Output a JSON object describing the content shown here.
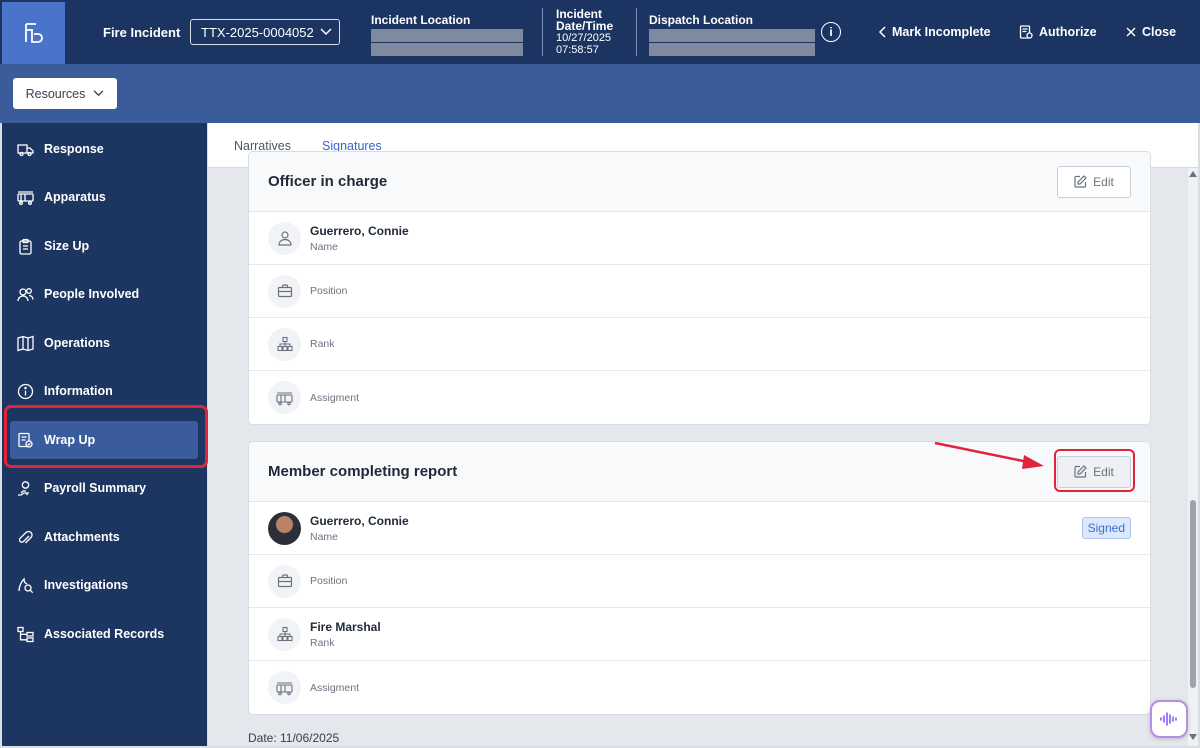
{
  "header": {
    "app_title": "Fire Incident",
    "incident_id": "TTX-2025-0004052",
    "incident_location_label": "Incident Location",
    "incident_datetime_label": "Incident Date/Time",
    "incident_date": "10/27/2025",
    "incident_time": "07:58:57",
    "dispatch_location_label": "Dispatch Location",
    "actions": {
      "mark_incomplete": "Mark Incomplete",
      "authorize": "Authorize",
      "close": "Close"
    }
  },
  "resources_button": "Resources",
  "sidebar": {
    "items": [
      {
        "label": "Response",
        "icon": "truck-icon"
      },
      {
        "label": "Apparatus",
        "icon": "fire-engine-icon"
      },
      {
        "label": "Size Up",
        "icon": "clipboard-icon"
      },
      {
        "label": "People Involved",
        "icon": "people-icon"
      },
      {
        "label": "Operations",
        "icon": "map-icon"
      },
      {
        "label": "Information",
        "icon": "info-icon"
      },
      {
        "label": "Wrap Up",
        "icon": "document-check-icon",
        "active": true
      },
      {
        "label": "Payroll Summary",
        "icon": "payroll-icon"
      },
      {
        "label": "Attachments",
        "icon": "paperclip-icon"
      },
      {
        "label": "Investigations",
        "icon": "investigation-icon"
      },
      {
        "label": "Associated Records",
        "icon": "hierarchy-icon"
      }
    ]
  },
  "tabs": [
    {
      "label": "Narratives"
    },
    {
      "label": "Signatures",
      "active": true
    }
  ],
  "officer_card": {
    "title": "Officer in charge",
    "edit_label": "Edit",
    "name_value": "Guerrero, Connie",
    "name_label": "Name",
    "position_label": "Position",
    "rank_label": "Rank",
    "assignment_label": "Assigment"
  },
  "member_card": {
    "title": "Member completing report",
    "edit_label": "Edit",
    "name_value": "Guerrero, Connie",
    "name_label": "Name",
    "signed_badge": "Signed",
    "position_label": "Position",
    "rank_value": "Fire Marshal",
    "rank_label": "Rank",
    "assignment_label": "Assigment"
  },
  "date_line": "Date: 11/06/2025",
  "colors": {
    "topbar": "#1c3461",
    "subbar": "#3a5c9a",
    "accent": "#3a63c4",
    "highlight": "#e0253a"
  }
}
